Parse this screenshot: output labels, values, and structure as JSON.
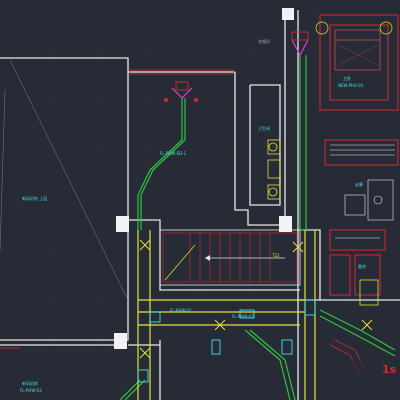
{
  "drawing": {
    "colors": {
      "background": "#262b36",
      "grid": "#2f3542",
      "wall": "#e8e8e8",
      "duct_green": "#31c43c",
      "duct_yellow": "#e3e33a",
      "text_cyan": "#44e0e6",
      "red": "#d8282c",
      "magenta": "#d63fd6",
      "gray": "#9aa0a8"
    },
    "labels": {
      "room_large_left": "新风机房 上层",
      "room_top_left": "卫生间",
      "room_mid": "衣帽间",
      "room_top_right": "主卧",
      "room_top_right_sub": "NEW-PH0-01",
      "room_right_mid": "走廊",
      "room_right_lower": "客房",
      "duct_label_upper": "FL-PHW-SD-1",
      "duct_label_mid": "FL-PHW-01",
      "duct_label_lower": "FL-PHW-02",
      "stair_tag": "T22",
      "room_bottom_left": "新风机房",
      "room_bottom_left_sub": "FL-PHW-03"
    },
    "watermark": "1s"
  }
}
